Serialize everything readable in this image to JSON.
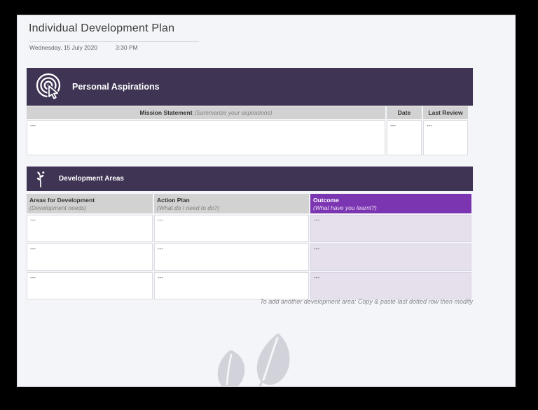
{
  "page": {
    "title": "Individual Development Plan",
    "date": "Wednesday, 15 July 2020",
    "time": "3:30 PM"
  },
  "aspirations": {
    "header_label": "Personal Aspirations",
    "icon": "target-cursor-icon",
    "table": {
      "columns": {
        "mission_label": "Mission Statement",
        "mission_hint": "(Summarize your aspirations)",
        "date_label": "Date",
        "last_review_label": "Last Review"
      },
      "row": {
        "mission": "---",
        "date": "---",
        "last_review": "---"
      }
    }
  },
  "development": {
    "header_label": "Development Areas",
    "icon": "sprout-icon",
    "table": {
      "columns": {
        "area_label": "Areas for Development",
        "area_hint": "(Development needs)",
        "action_label": "Action Plan",
        "action_hint": "(What do I need to do?)",
        "outcome_label": "Outcome",
        "outcome_hint": "(What have you learnt?)"
      },
      "rows": [
        {
          "area": "---",
          "action": "---",
          "outcome": "---"
        },
        {
          "area": "---",
          "action": "---",
          "outcome": "---"
        },
        {
          "area": "---",
          "action": "---",
          "outcome": "---"
        }
      ]
    },
    "footnote": "To add another development area: Copy & paste last dotted row then modify"
  },
  "colors": {
    "banner_purple": "#3f3454",
    "outcome_purple": "#7c35b1",
    "outcome_light": "#e5e0ec",
    "header_gray": "#d2d2d2",
    "page_bg": "#f4f5f8",
    "watermark_gray": "#d2d3da"
  }
}
